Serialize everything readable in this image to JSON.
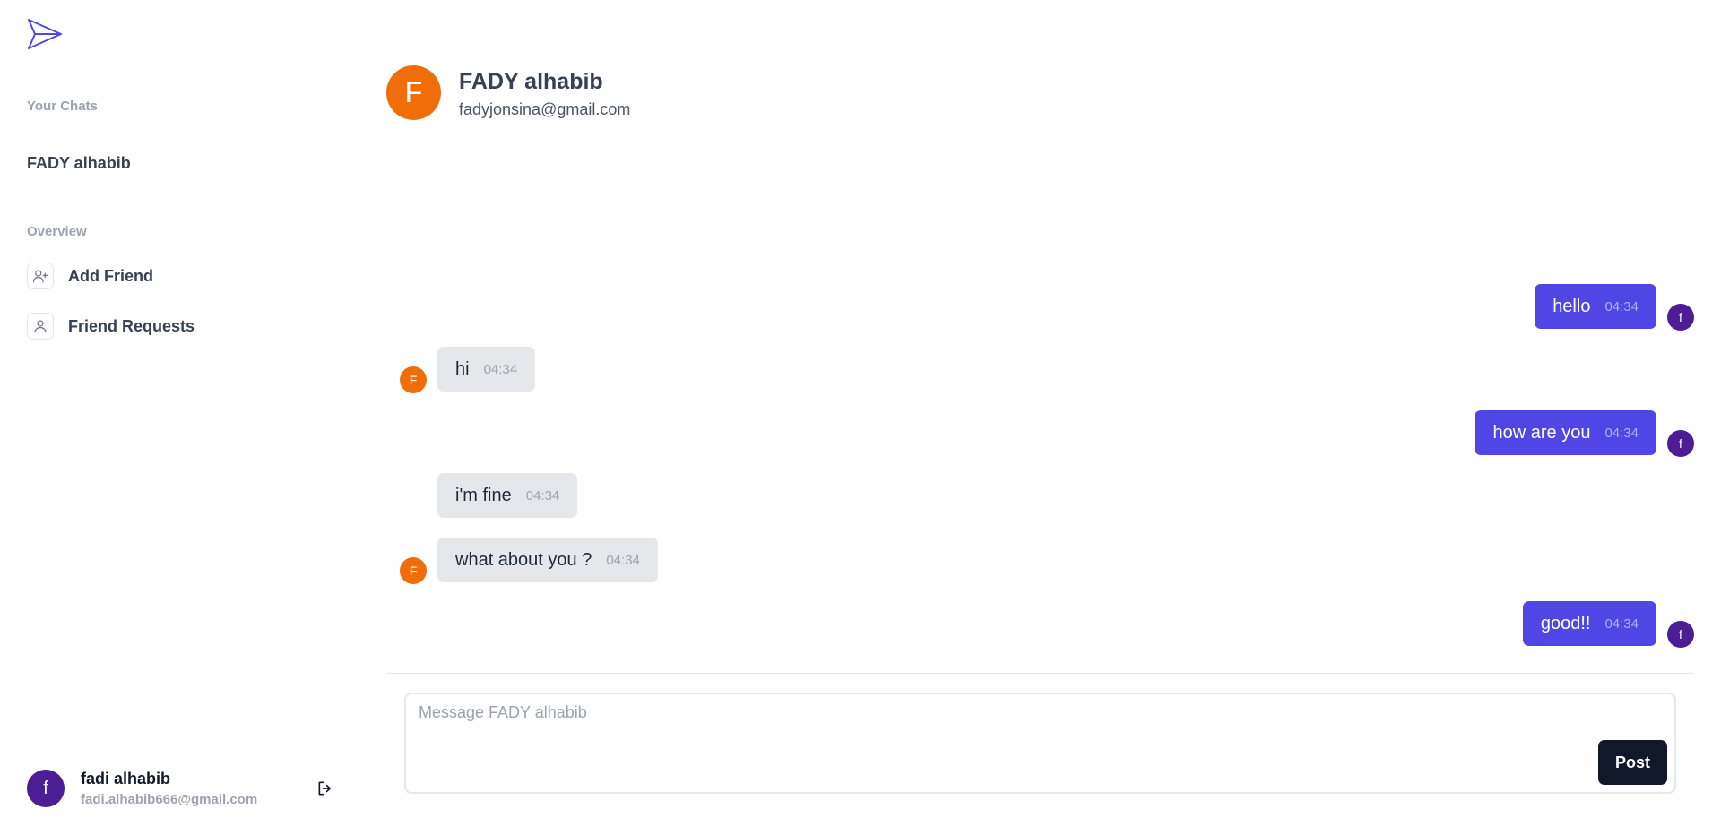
{
  "sidebar": {
    "your_chats_label": "Your Chats",
    "chats": [
      {
        "name": "FADY alhabib"
      }
    ],
    "overview_label": "Overview",
    "nav": [
      {
        "label": "Add Friend",
        "icon": "user-plus-icon"
      },
      {
        "label": "Friend Requests",
        "icon": "user-icon"
      }
    ],
    "profile": {
      "initial": "f",
      "name": "fadi alhabib",
      "email": "fadi.alhabib666@gmail.com"
    }
  },
  "header": {
    "initial": "F",
    "name": "FADY alhabib",
    "email": "fadyjonsina@gmail.com"
  },
  "messages": [
    {
      "text": "hello",
      "time": "04:34",
      "mine": true,
      "avatar": "f"
    },
    {
      "text": "hi",
      "time": "04:34",
      "mine": false,
      "avatar": "F"
    },
    {
      "text": "how are you",
      "time": "04:34",
      "mine": true,
      "avatar": "f"
    },
    {
      "text": "i'm fine",
      "time": "04:34",
      "mine": false,
      "avatar": ""
    },
    {
      "text": "what about you ?",
      "time": "04:34",
      "mine": false,
      "avatar": "F"
    },
    {
      "text": "good!!",
      "time": "04:34",
      "mine": true,
      "avatar": "f"
    }
  ],
  "composer": {
    "placeholder": "Message FADY alhabib",
    "value": "",
    "post_label": "Post"
  },
  "colors": {
    "accent": "#4f46e5",
    "self_avatar": "#4c1d95",
    "friend_avatar": "#f06e0a",
    "button_dark": "#111827"
  }
}
